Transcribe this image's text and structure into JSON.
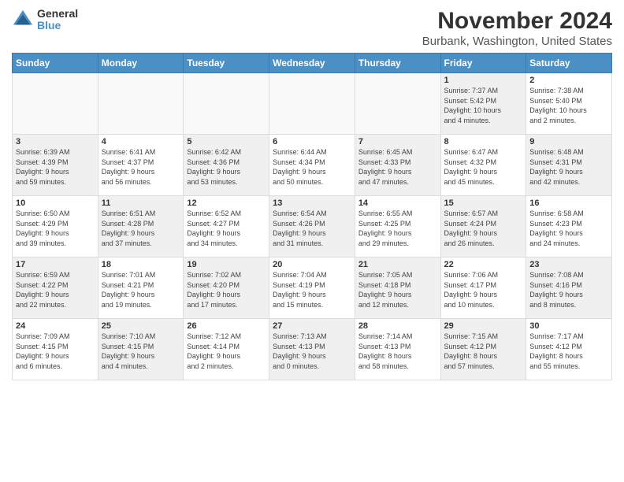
{
  "logo": {
    "general": "General",
    "blue": "Blue"
  },
  "title": "November 2024",
  "location": "Burbank, Washington, United States",
  "days_of_week": [
    "Sunday",
    "Monday",
    "Tuesday",
    "Wednesday",
    "Thursday",
    "Friday",
    "Saturday"
  ],
  "weeks": [
    [
      {
        "day": "",
        "info": "",
        "empty": true
      },
      {
        "day": "",
        "info": "",
        "empty": true
      },
      {
        "day": "",
        "info": "",
        "empty": true
      },
      {
        "day": "",
        "info": "",
        "empty": true
      },
      {
        "day": "",
        "info": "",
        "empty": true
      },
      {
        "day": "1",
        "info": "Sunrise: 7:37 AM\nSunset: 5:42 PM\nDaylight: 10 hours\nand 4 minutes.",
        "shaded": true
      },
      {
        "day": "2",
        "info": "Sunrise: 7:38 AM\nSunset: 5:40 PM\nDaylight: 10 hours\nand 2 minutes.",
        "shaded": false
      }
    ],
    [
      {
        "day": "3",
        "info": "Sunrise: 6:39 AM\nSunset: 4:39 PM\nDaylight: 9 hours\nand 59 minutes.",
        "shaded": true
      },
      {
        "day": "4",
        "info": "Sunrise: 6:41 AM\nSunset: 4:37 PM\nDaylight: 9 hours\nand 56 minutes.",
        "shaded": false
      },
      {
        "day": "5",
        "info": "Sunrise: 6:42 AM\nSunset: 4:36 PM\nDaylight: 9 hours\nand 53 minutes.",
        "shaded": true
      },
      {
        "day": "6",
        "info": "Sunrise: 6:44 AM\nSunset: 4:34 PM\nDaylight: 9 hours\nand 50 minutes.",
        "shaded": false
      },
      {
        "day": "7",
        "info": "Sunrise: 6:45 AM\nSunset: 4:33 PM\nDaylight: 9 hours\nand 47 minutes.",
        "shaded": true
      },
      {
        "day": "8",
        "info": "Sunrise: 6:47 AM\nSunset: 4:32 PM\nDaylight: 9 hours\nand 45 minutes.",
        "shaded": false
      },
      {
        "day": "9",
        "info": "Sunrise: 6:48 AM\nSunset: 4:31 PM\nDaylight: 9 hours\nand 42 minutes.",
        "shaded": true
      }
    ],
    [
      {
        "day": "10",
        "info": "Sunrise: 6:50 AM\nSunset: 4:29 PM\nDaylight: 9 hours\nand 39 minutes.",
        "shaded": false
      },
      {
        "day": "11",
        "info": "Sunrise: 6:51 AM\nSunset: 4:28 PM\nDaylight: 9 hours\nand 37 minutes.",
        "shaded": true
      },
      {
        "day": "12",
        "info": "Sunrise: 6:52 AM\nSunset: 4:27 PM\nDaylight: 9 hours\nand 34 minutes.",
        "shaded": false
      },
      {
        "day": "13",
        "info": "Sunrise: 6:54 AM\nSunset: 4:26 PM\nDaylight: 9 hours\nand 31 minutes.",
        "shaded": true
      },
      {
        "day": "14",
        "info": "Sunrise: 6:55 AM\nSunset: 4:25 PM\nDaylight: 9 hours\nand 29 minutes.",
        "shaded": false
      },
      {
        "day": "15",
        "info": "Sunrise: 6:57 AM\nSunset: 4:24 PM\nDaylight: 9 hours\nand 26 minutes.",
        "shaded": true
      },
      {
        "day": "16",
        "info": "Sunrise: 6:58 AM\nSunset: 4:23 PM\nDaylight: 9 hours\nand 24 minutes.",
        "shaded": false
      }
    ],
    [
      {
        "day": "17",
        "info": "Sunrise: 6:59 AM\nSunset: 4:22 PM\nDaylight: 9 hours\nand 22 minutes.",
        "shaded": true
      },
      {
        "day": "18",
        "info": "Sunrise: 7:01 AM\nSunset: 4:21 PM\nDaylight: 9 hours\nand 19 minutes.",
        "shaded": false
      },
      {
        "day": "19",
        "info": "Sunrise: 7:02 AM\nSunset: 4:20 PM\nDaylight: 9 hours\nand 17 minutes.",
        "shaded": true
      },
      {
        "day": "20",
        "info": "Sunrise: 7:04 AM\nSunset: 4:19 PM\nDaylight: 9 hours\nand 15 minutes.",
        "shaded": false
      },
      {
        "day": "21",
        "info": "Sunrise: 7:05 AM\nSunset: 4:18 PM\nDaylight: 9 hours\nand 12 minutes.",
        "shaded": true
      },
      {
        "day": "22",
        "info": "Sunrise: 7:06 AM\nSunset: 4:17 PM\nDaylight: 9 hours\nand 10 minutes.",
        "shaded": false
      },
      {
        "day": "23",
        "info": "Sunrise: 7:08 AM\nSunset: 4:16 PM\nDaylight: 9 hours\nand 8 minutes.",
        "shaded": true
      }
    ],
    [
      {
        "day": "24",
        "info": "Sunrise: 7:09 AM\nSunset: 4:15 PM\nDaylight: 9 hours\nand 6 minutes.",
        "shaded": false
      },
      {
        "day": "25",
        "info": "Sunrise: 7:10 AM\nSunset: 4:15 PM\nDaylight: 9 hours\nand 4 minutes.",
        "shaded": true
      },
      {
        "day": "26",
        "info": "Sunrise: 7:12 AM\nSunset: 4:14 PM\nDaylight: 9 hours\nand 2 minutes.",
        "shaded": false
      },
      {
        "day": "27",
        "info": "Sunrise: 7:13 AM\nSunset: 4:13 PM\nDaylight: 9 hours\nand 0 minutes.",
        "shaded": true
      },
      {
        "day": "28",
        "info": "Sunrise: 7:14 AM\nSunset: 4:13 PM\nDaylight: 8 hours\nand 58 minutes.",
        "shaded": false
      },
      {
        "day": "29",
        "info": "Sunrise: 7:15 AM\nSunset: 4:12 PM\nDaylight: 8 hours\nand 57 minutes.",
        "shaded": true
      },
      {
        "day": "30",
        "info": "Sunrise: 7:17 AM\nSunset: 4:12 PM\nDaylight: 8 hours\nand 55 minutes.",
        "shaded": false
      }
    ]
  ]
}
